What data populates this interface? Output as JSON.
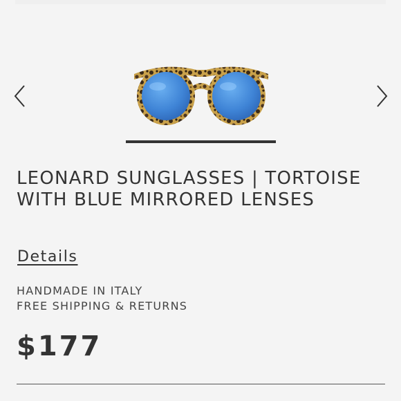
{
  "product": {
    "title": "LEONARD SUNGLASSES | TORTOISE WITH BLUE MIRRORED LENSES",
    "details_label": "Details",
    "features": [
      "HANDMADE IN ITALY",
      "FREE SHIPPING & RETURNS"
    ],
    "price": "$177"
  },
  "carousel": {
    "prev_icon": "chevron-left-icon",
    "next_icon": "chevron-right-icon",
    "image_subject": "tortoise sunglasses with blue mirrored lenses"
  },
  "colors": {
    "text": "#333333",
    "background": "#f4f4f4",
    "lens_blue": "#3f84d6",
    "tortoise_light": "#c9a14a",
    "tortoise_dark": "#3a2a18"
  }
}
